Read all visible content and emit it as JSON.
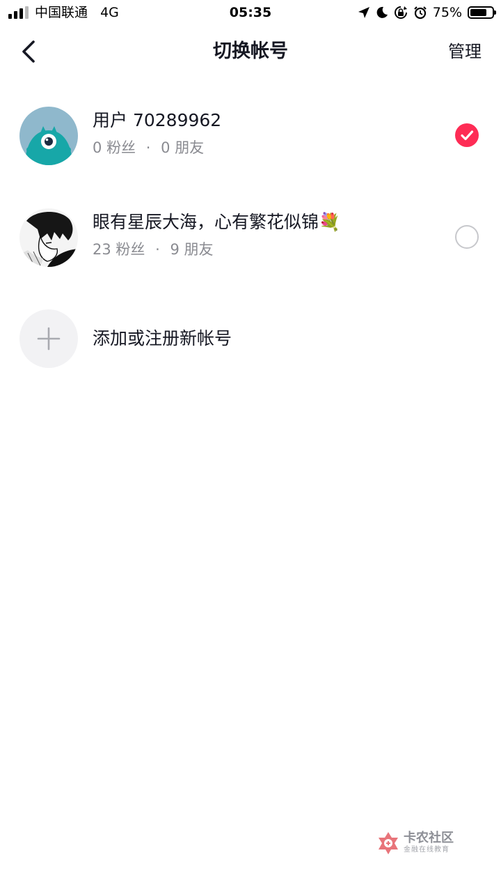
{
  "status_bar": {
    "carrier": "中国联通",
    "network": "4G",
    "time": "05:35",
    "battery_percent": "75%",
    "battery_level": 0.75,
    "icons": [
      "signal-icon",
      "location-icon",
      "do-not-disturb-icon",
      "orientation-lock-icon",
      "alarm-icon",
      "battery-icon"
    ]
  },
  "nav": {
    "title": "切换帐号",
    "manage_label": "管理",
    "back_icon": "chevron-left-icon"
  },
  "accounts": [
    {
      "name": "用户 70289962",
      "followers_count": "0",
      "followers_label": "粉丝",
      "separator": "·",
      "friends_count": "0",
      "friends_label": "朋友",
      "selected": true
    },
    {
      "name": "眼有星辰大海，心有繁花似锦💐",
      "followers_count": "23",
      "followers_label": "粉丝",
      "separator": "·",
      "friends_count": "9",
      "friends_label": "朋友",
      "selected": false
    }
  ],
  "add_account": {
    "label": "添加或注册新帐号",
    "icon": "plus-icon"
  },
  "watermark": {
    "title": "卡农社区",
    "subtitle": "金融在线教育"
  },
  "colors": {
    "accent": "#fe2c55",
    "text_primary": "#161823",
    "text_secondary": "#8a8b91",
    "radio_border": "#c7c8cc",
    "add_circle_bg": "#f2f2f4"
  }
}
